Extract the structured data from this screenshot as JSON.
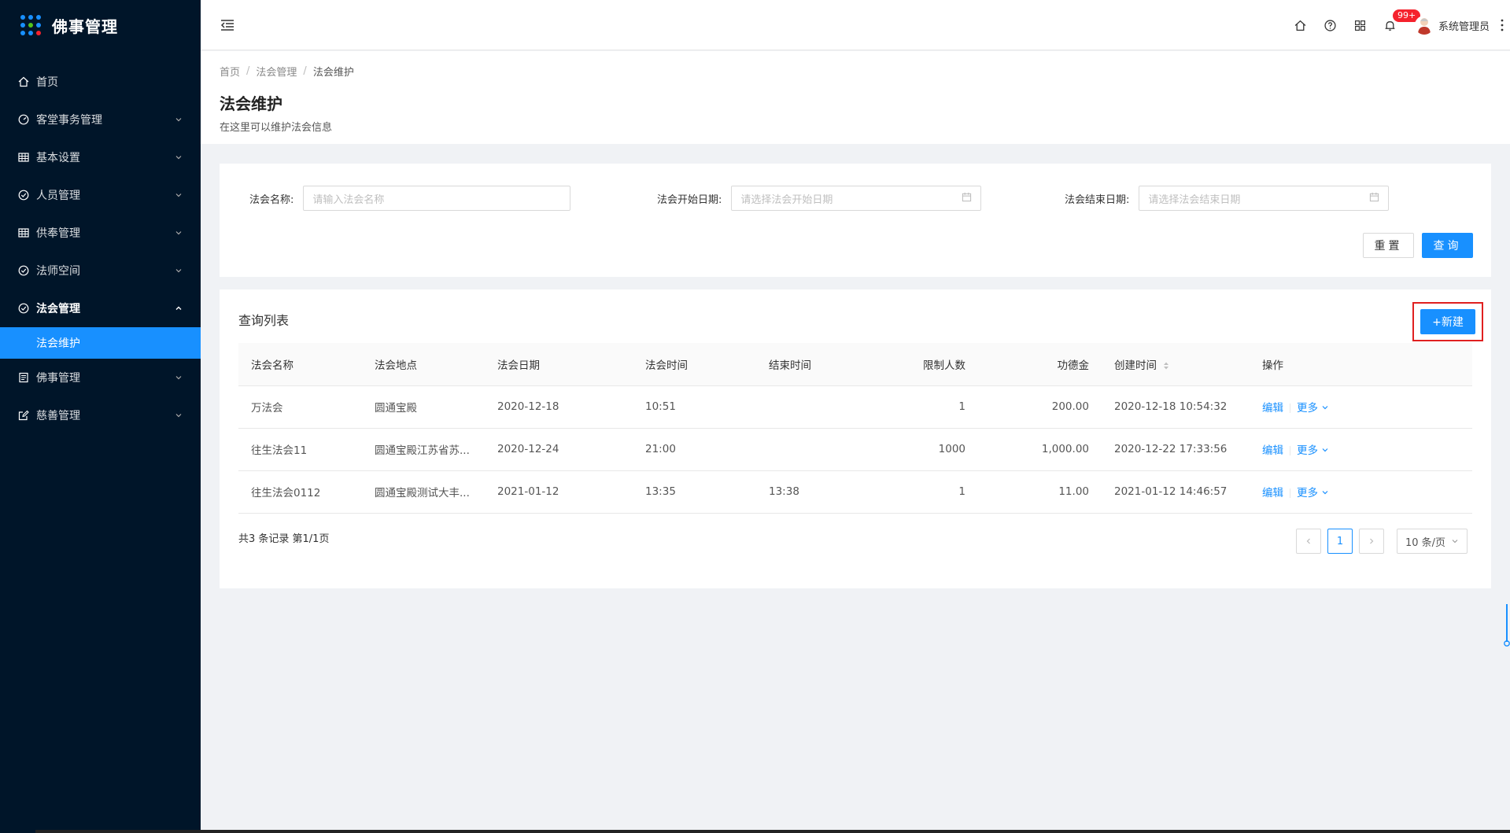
{
  "app": {
    "title": "佛事管理",
    "logo_dot_colors": [
      "#1890ff",
      "#1890ff",
      "#1890ff",
      "#1890ff",
      "#52c41a",
      "#1890ff",
      "#1890ff",
      "#1890ff",
      "#f5222d"
    ]
  },
  "sidebar": {
    "items": [
      {
        "label": "首页",
        "icon": "home-icon"
      },
      {
        "label": "客堂事务管理",
        "icon": "dashboard-icon"
      },
      {
        "label": "基本设置",
        "icon": "table-icon"
      },
      {
        "label": "人员管理",
        "icon": "check-circle-icon"
      },
      {
        "label": "供奉管理",
        "icon": "table-icon"
      },
      {
        "label": "法师空间",
        "icon": "check-circle-icon"
      },
      {
        "label": "法会管理",
        "icon": "check-circle-icon"
      },
      {
        "label": "佛事管理",
        "icon": "profile-icon"
      },
      {
        "label": "慈善管理",
        "icon": "edit-icon"
      }
    ],
    "active_sub": "法会维护"
  },
  "header": {
    "notification_count": "99+",
    "user_name": "系统管理员"
  },
  "breadcrumb": [
    "首页",
    "法会管理",
    "法会维护"
  ],
  "page": {
    "title": "法会维护",
    "description": "在这里可以维护法会信息"
  },
  "search": {
    "name_label": "法会名称:",
    "name_placeholder": "请输入法会名称",
    "start_label": "法会开始日期:",
    "start_placeholder": "请选择法会开始日期",
    "end_label": "法会结束日期:",
    "end_placeholder": "请选择法会结束日期",
    "reset_label": "重置",
    "query_label": "查询"
  },
  "list": {
    "title": "查询列表",
    "new_label": "+新建",
    "columns": [
      "法会名称",
      "法会地点",
      "法会日期",
      "法会时间",
      "结束时间",
      "限制人数",
      "功德金",
      "创建时间",
      "操作"
    ],
    "rows": [
      {
        "name": "万法会",
        "place": "圆通宝殿",
        "date": "2020-12-18",
        "time": "10:51",
        "end": "",
        "limit": "1",
        "merit": "200.00",
        "created": "2020-12-18 10:54:32",
        "edit": "编辑",
        "more": "更多"
      },
      {
        "name": "往生法会11",
        "place": "圆通宝殿江苏省苏...",
        "date": "2020-12-24",
        "time": "21:00",
        "end": "",
        "limit": "1000",
        "merit": "1,000.00",
        "created": "2020-12-22 17:33:56",
        "edit": "编辑",
        "more": "更多"
      },
      {
        "name": "往生法会0112",
        "place": "圆通宝殿测试大丰...",
        "date": "2021-01-12",
        "time": "13:35",
        "end": "13:38",
        "limit": "1",
        "merit": "11.00",
        "created": "2021-01-12 14:46:57",
        "edit": "编辑",
        "more": "更多"
      }
    ],
    "summary": "共3 条记录 第1/1页",
    "current_page": "1",
    "page_size": "10 条/页"
  }
}
